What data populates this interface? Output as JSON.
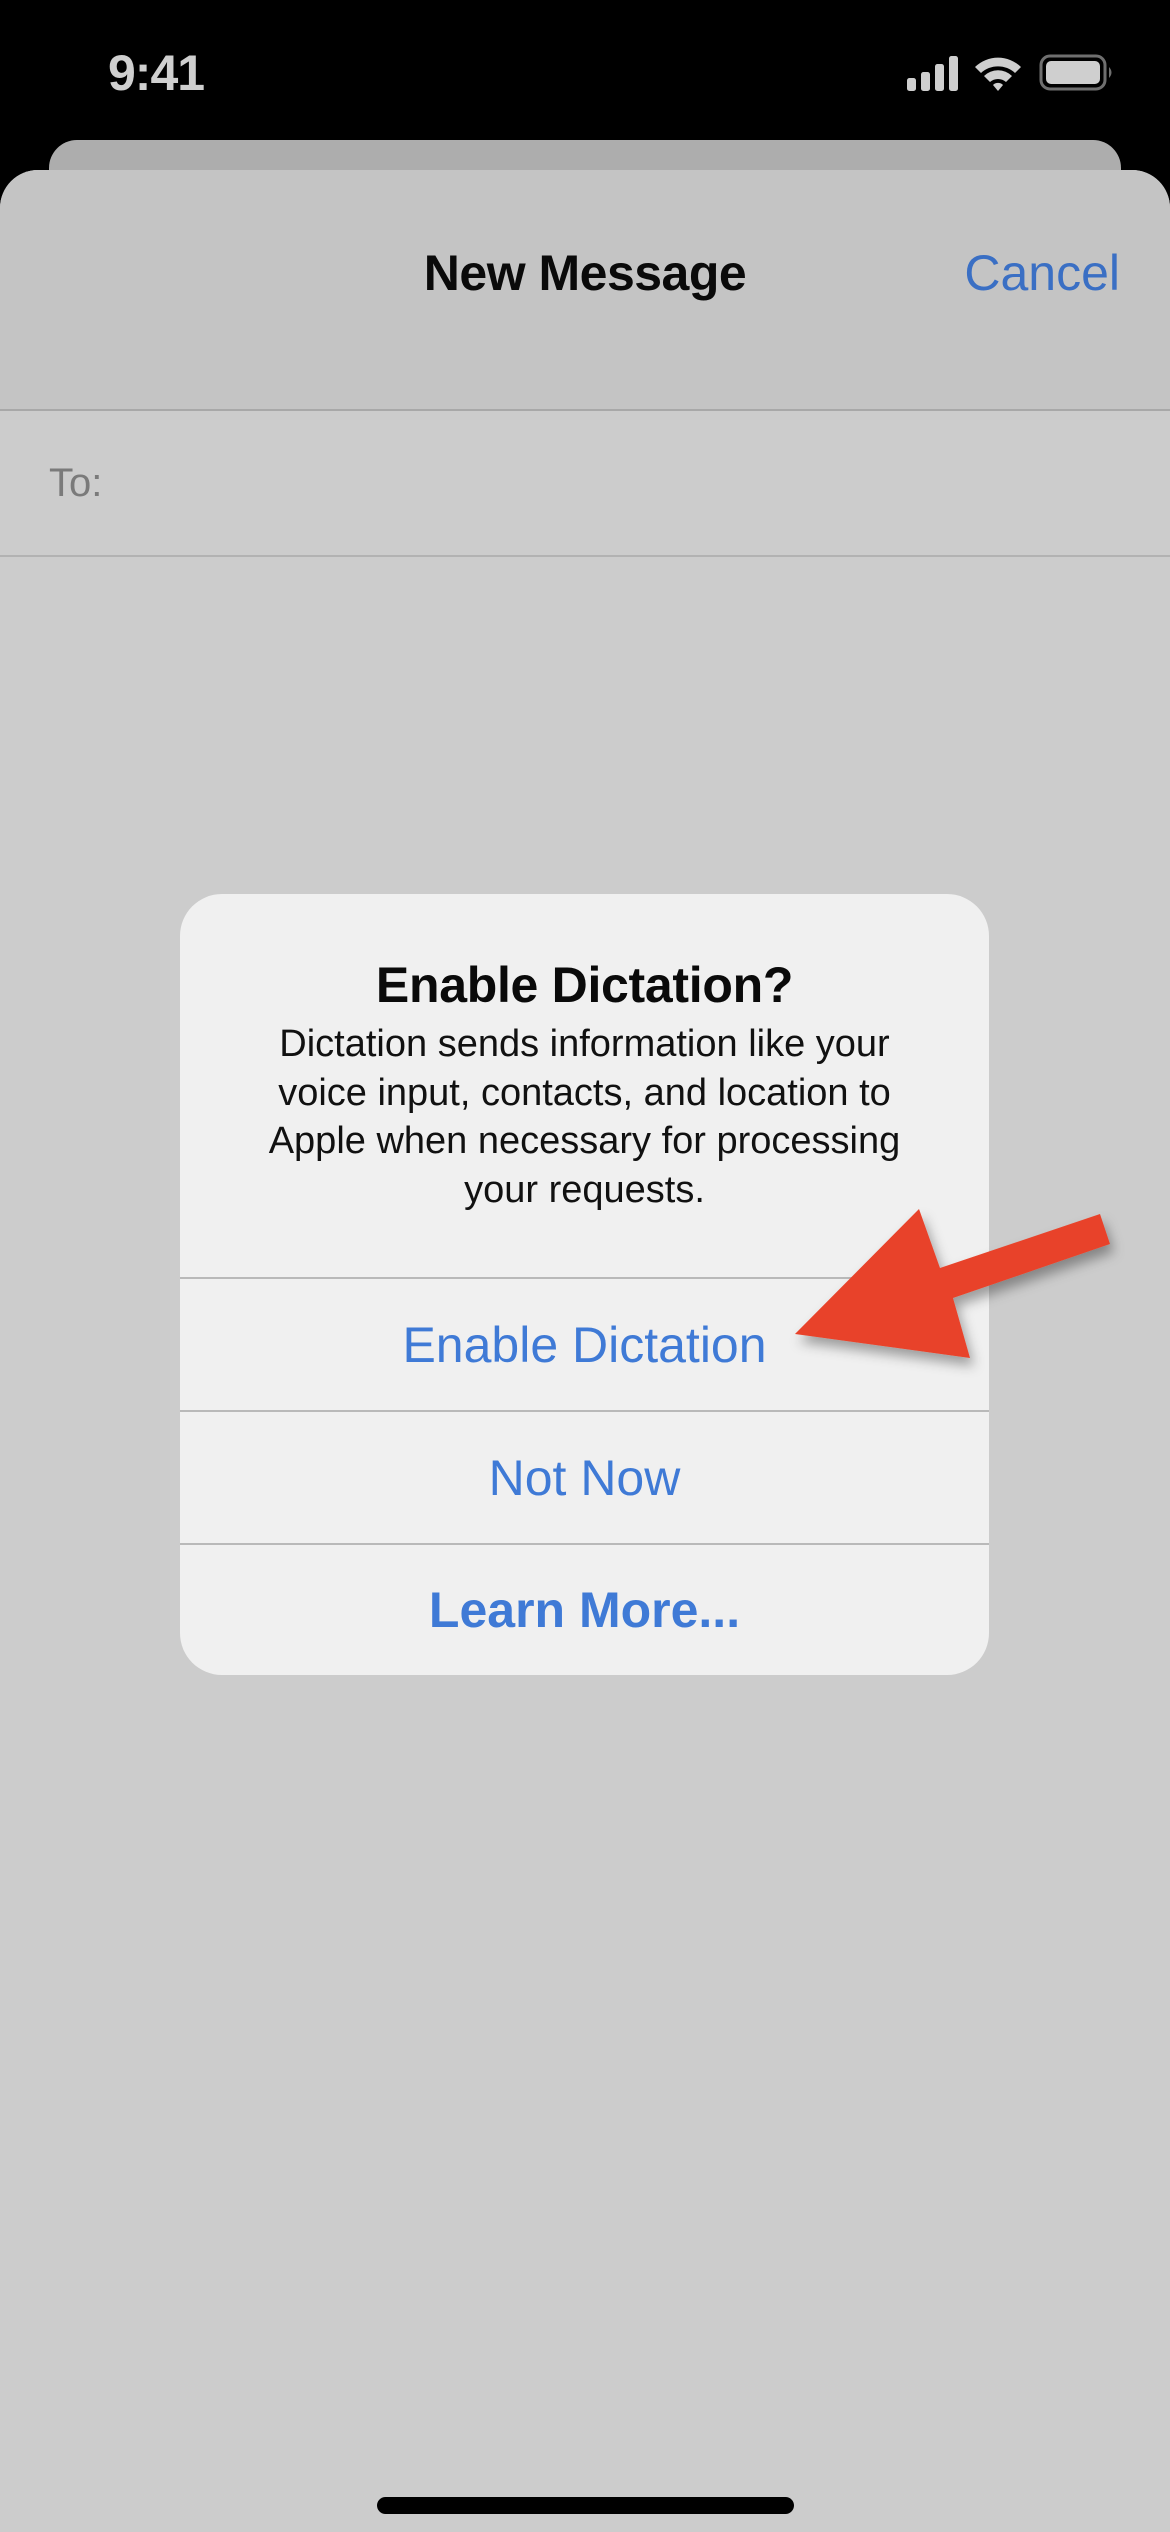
{
  "status_bar": {
    "time": "9:41",
    "icons": [
      "cellular-signal-icon",
      "wifi-icon",
      "battery-icon"
    ]
  },
  "compose": {
    "title": "New Message",
    "cancel_label": "Cancel",
    "to_label": "To:",
    "to_value": ""
  },
  "alert": {
    "title": "Enable Dictation?",
    "message": "Dictation sends information like your voice input, contacts, and location to Apple when necessary for processing your requests.",
    "buttons": [
      {
        "label": "Enable Dictation",
        "style": "default"
      },
      {
        "label": "Not Now",
        "style": "default"
      },
      {
        "label": "Learn More...",
        "style": "preferred"
      }
    ]
  },
  "annotation": {
    "type": "arrow",
    "points_to": "Enable Dictation",
    "color": "#e8432a"
  },
  "colors": {
    "accent_blue": "#3f7ad6",
    "nav_blue": "#3a6fc4",
    "dim_background": "#cccccc",
    "alert_background": "#f0f0f0"
  }
}
